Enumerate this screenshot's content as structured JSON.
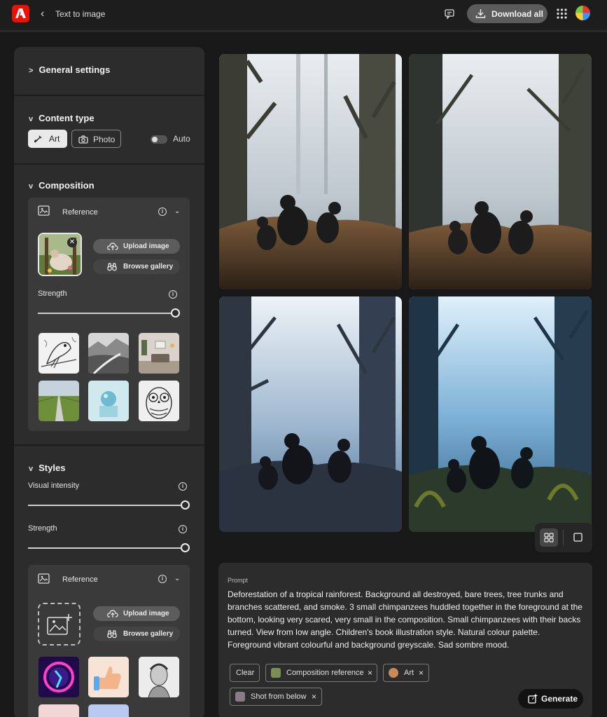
{
  "header": {
    "title": "Text to image",
    "download_label": "Download all",
    "brand_color": "#eb1000"
  },
  "sidebar": {
    "general_settings": "General settings",
    "content_type": {
      "title": "Content type",
      "art_label": "Art",
      "photo_label": "Photo",
      "auto_label": "Auto",
      "auto_on": false
    },
    "composition": {
      "title": "Composition",
      "reference_label": "Reference",
      "upload_label": "Upload image",
      "browse_label": "Browse gallery",
      "strength_label": "Strength",
      "strength_value": 1.0,
      "thumbnails": [
        "blue-jay-sketch",
        "desert-road-landscape",
        "living-room-interior",
        "green-field-road",
        "sphere-on-block",
        "owl-line-art"
      ]
    },
    "styles": {
      "title": "Styles",
      "visual_intensity_label": "Visual intensity",
      "visual_intensity_value": 1.0,
      "strength_label": "Strength",
      "strength_value": 1.0,
      "reference_label": "Reference",
      "upload_label": "Upload image",
      "browse_label": "Browse gallery",
      "thumbnails": [
        "neon-figure",
        "thumbs-up-3d",
        "classical-portrait-sketch"
      ]
    }
  },
  "gallery": {
    "images": [
      "chimpanzees-misty-forest-1",
      "chimpanzees-misty-forest-2",
      "chimpanzees-misty-forest-3",
      "chimpanzees-misty-forest-4"
    ],
    "view_mode": "grid"
  },
  "prompt": {
    "label": "Prompt",
    "text": "Deforestation of a tropical rainforest. Background all destroyed, bare trees, tree trunks and branches scattered, and smoke. 3 small chimpanzees huddled together in the foreground at the bottom, looking very scared, very small in the composition. Small chimpanzees with their backs turned. View from low angle. Children's book illustration style. Natural colour palette. Foreground vibrant colourful and background greyscale. Sad sombre mood.",
    "chips": {
      "clear": "Clear",
      "composition_reference": "Composition reference",
      "art": "Art",
      "shot_from_below": "Shot from below"
    },
    "generate_label": "Generate"
  }
}
